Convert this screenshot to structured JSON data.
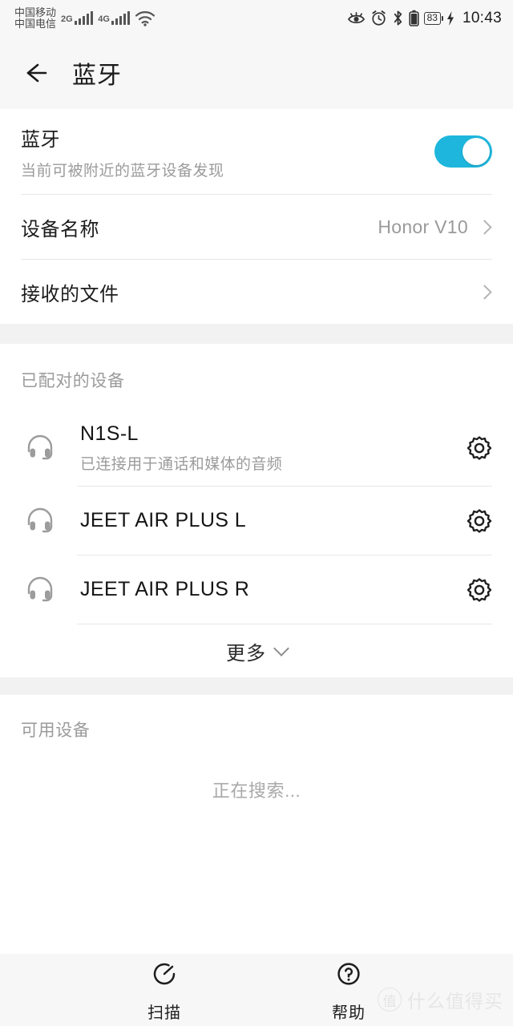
{
  "status_bar": {
    "carrier_1": "中国移动",
    "carrier_2": "中国电信",
    "network_1": "2G",
    "network_2": "4G",
    "wifi_icon": "wifi-icon",
    "eye_comfort_icon": "eye-comfort-icon",
    "alarm_icon": "alarm-clock-icon",
    "bluetooth_icon": "bluetooth-icon",
    "battery_icon": "battery-icon",
    "battery_percent": "83",
    "charging_icon": "charging-bolt-icon",
    "time": "10:43"
  },
  "header": {
    "back_icon": "back-arrow-icon",
    "title": "蓝牙"
  },
  "bluetooth_switch": {
    "title": "蓝牙",
    "subtitle": "当前可被附近的蓝牙设备发现",
    "enabled": true,
    "accent_color": "#1eb6dc"
  },
  "settings_rows": [
    {
      "label": "设备名称",
      "value": "Honor V10",
      "chevron": "chevron-right-icon"
    },
    {
      "label": "接收的文件",
      "value": "",
      "chevron": "chevron-right-icon"
    }
  ],
  "paired": {
    "header": "已配对的设备",
    "devices": [
      {
        "name": "N1S-L",
        "status": "已连接用于通话和媒体的音频",
        "icon": "headset-icon",
        "settings_icon": "gear-icon"
      },
      {
        "name": "JEET AIR PLUS L",
        "status": "",
        "icon": "headset-icon",
        "settings_icon": "gear-icon"
      },
      {
        "name": "JEET AIR PLUS R",
        "status": "",
        "icon": "headset-icon",
        "settings_icon": "gear-icon"
      }
    ],
    "more_label": "更多",
    "more_icon": "chevron-down-icon"
  },
  "available": {
    "header": "可用设备",
    "status_text": "正在搜索..."
  },
  "bottom_bar": {
    "items": [
      {
        "label": "扫描",
        "icon": "scan-refresh-icon"
      },
      {
        "label": "帮助",
        "icon": "help-question-icon"
      }
    ]
  },
  "watermark": {
    "logo_char": "值",
    "text": "什么值得买"
  }
}
